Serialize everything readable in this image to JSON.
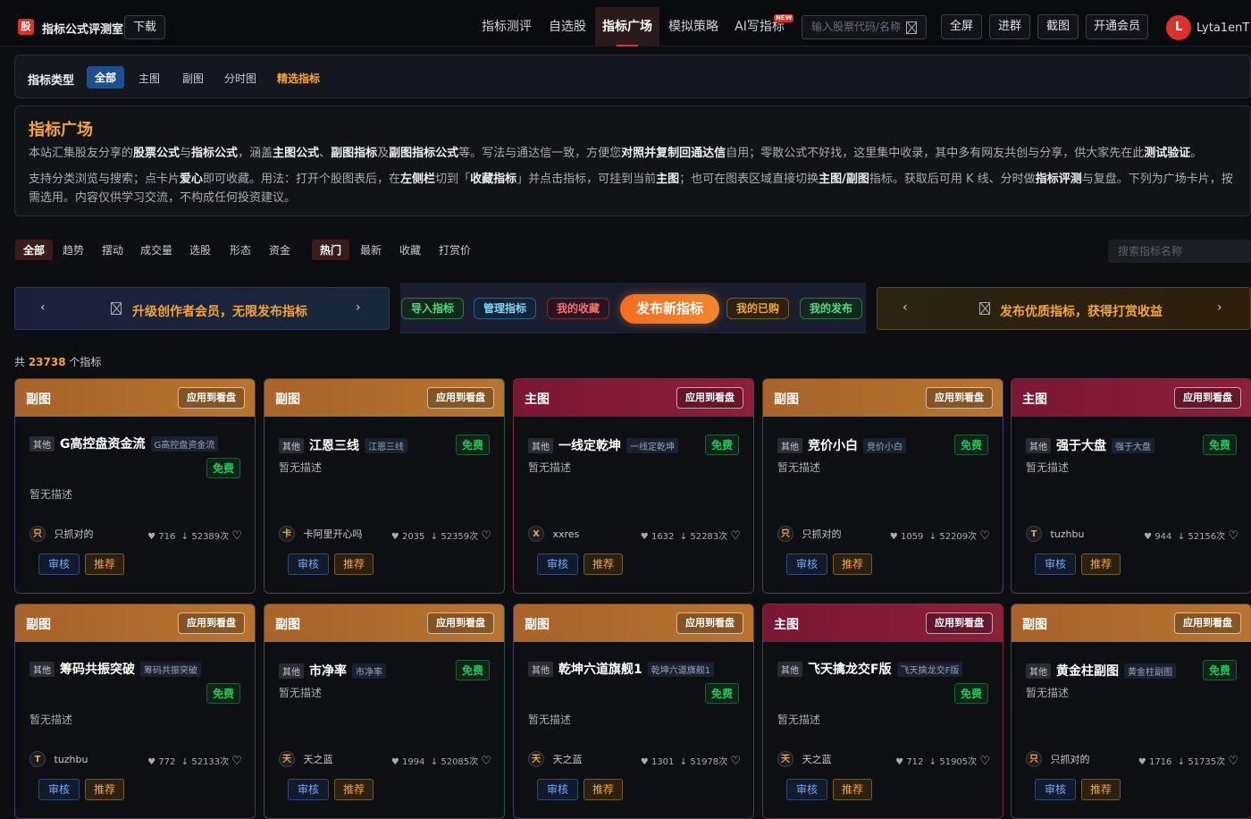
{
  "app": {
    "logo": "股",
    "title": "指标公式评测室",
    "download": "下载"
  },
  "nav": {
    "items": [
      "指标测评",
      "自选股",
      "指标广场",
      "模拟策略",
      "AI写指标"
    ],
    "new_badge": "NEW",
    "search_placeholder": "输入股票代码/名称"
  },
  "actions": [
    "全屏",
    "进群",
    "截图",
    "开通会员"
  ],
  "user": {
    "initial": "L",
    "name": "Lyta1enT"
  },
  "typebar": {
    "label": "指标类型",
    "items": [
      "全部",
      "主图",
      "副图",
      "分时图",
      "精选指标"
    ]
  },
  "intro": {
    "title": "指标广场",
    "p1": [
      "本站汇集股友分享的",
      "股票公式",
      "与",
      "指标公式",
      "，涵盖",
      "主图公式",
      "、",
      "副图指标",
      "及",
      "副图指标公式",
      "等。写法与通达信一致，方便您",
      "对照并复制回通达信",
      "自用；零散公式不好找，这里集中收录，其中多有网友共创与分享，供大家先在此",
      "测试验证",
      "。"
    ],
    "p2": [
      "支持分类浏览与搜索；点卡片",
      "爱心",
      "即可收藏。用法：打开个股图表后，在",
      "左侧栏",
      "切到「",
      "收藏指标",
      "」并点击指标，可挂到当前",
      "主图",
      "；也可在图表区域直接切换",
      "主图/副图",
      "指标。获取后可用 K 线、分时做",
      "指标评测",
      "与复盘。下列为广场卡片，按"
    ],
    "p3": "需选用。内容仅供学习交流，不构成任何投资建议。"
  },
  "filters": {
    "left": [
      "全部",
      "趋势",
      "摆动",
      "成交量",
      "选股",
      "形态",
      "资金"
    ],
    "right": [
      "热门",
      "最新",
      "收藏",
      "打赏价"
    ],
    "search_placeholder": "搜索指标名称"
  },
  "banners": {
    "left": "升级创作者会员，无限发布指标",
    "right": "发布优质指标，获得打赏收益"
  },
  "pills": {
    "import": "导入指标",
    "manage": "管理指标",
    "fav": "我的收藏",
    "publish": "发布新指标",
    "bought": "我的已购",
    "mine": "我的发布"
  },
  "total": {
    "prefix": "共 ",
    "count": "23738",
    "suffix": " 个指标"
  },
  "card_labels": {
    "apply": "应用到看盘",
    "tag": "其他",
    "free": "免费",
    "desc": "暂无描述",
    "review": "审核",
    "recommend": "推荐"
  },
  "cards": [
    {
      "kind": "副图",
      "name": "G高控盘资金流",
      "alias": "G高控盘资金流",
      "author": "只抓对的",
      "initial": "只",
      "likes": "716",
      "downloads": "52389次",
      "wrap": true
    },
    {
      "kind": "副图",
      "name": "江恩三线",
      "alias": "江恩三线",
      "author": "卡阿里开心吗",
      "initial": "卡",
      "likes": "2035",
      "downloads": "52359次",
      "wrap": false
    },
    {
      "kind": "主图",
      "name": "一线定乾坤",
      "alias": "一线定乾坤",
      "author": "xxres",
      "initial": "X",
      "likes": "1632",
      "downloads": "52283次",
      "wrap": false
    },
    {
      "kind": "副图",
      "name": "竞价小白",
      "alias": "竞价小白",
      "author": "只抓对的",
      "initial": "只",
      "likes": "1059",
      "downloads": "52209次",
      "wrap": false
    },
    {
      "kind": "主图",
      "name": "强于大盘",
      "alias": "强于大盘",
      "author": "tuzhbu",
      "initial": "T",
      "likes": "944",
      "downloads": "52156次",
      "wrap": false
    },
    {
      "kind": "副图",
      "name": "筹码共振突破",
      "alias": "筹码共振突破",
      "author": "tuzhbu",
      "initial": "T",
      "likes": "772",
      "downloads": "52133次",
      "wrap": true
    },
    {
      "kind": "副图",
      "name": "市净率",
      "alias": "市净率",
      "author": "天之蓝",
      "initial": "天",
      "likes": "1994",
      "downloads": "52085次",
      "wrap": false
    },
    {
      "kind": "副图",
      "name": "乾坤六道旗舰1",
      "alias": "乾坤六道旗舰1",
      "author": "天之蓝",
      "initial": "天",
      "likes": "1301",
      "downloads": "51978次",
      "wrap": true
    },
    {
      "kind": "主图",
      "name": "飞天擒龙交F版",
      "alias": "飞天擒龙交F版",
      "author": "天之蓝",
      "initial": "天",
      "likes": "712",
      "downloads": "51905次",
      "wrap": true
    },
    {
      "kind": "副图",
      "name": "黄金柱副图",
      "alias": "黄金柱副图",
      "author": "只抓对的",
      "initial": "只",
      "likes": "1716",
      "downloads": "51735次",
      "wrap": false
    }
  ],
  "colors": {
    "accent": "#e0302c",
    "orange": "#f4a534",
    "free": "#22c55e",
    "main_header": "#7a1733",
    "sub_header": "#a8642a"
  }
}
